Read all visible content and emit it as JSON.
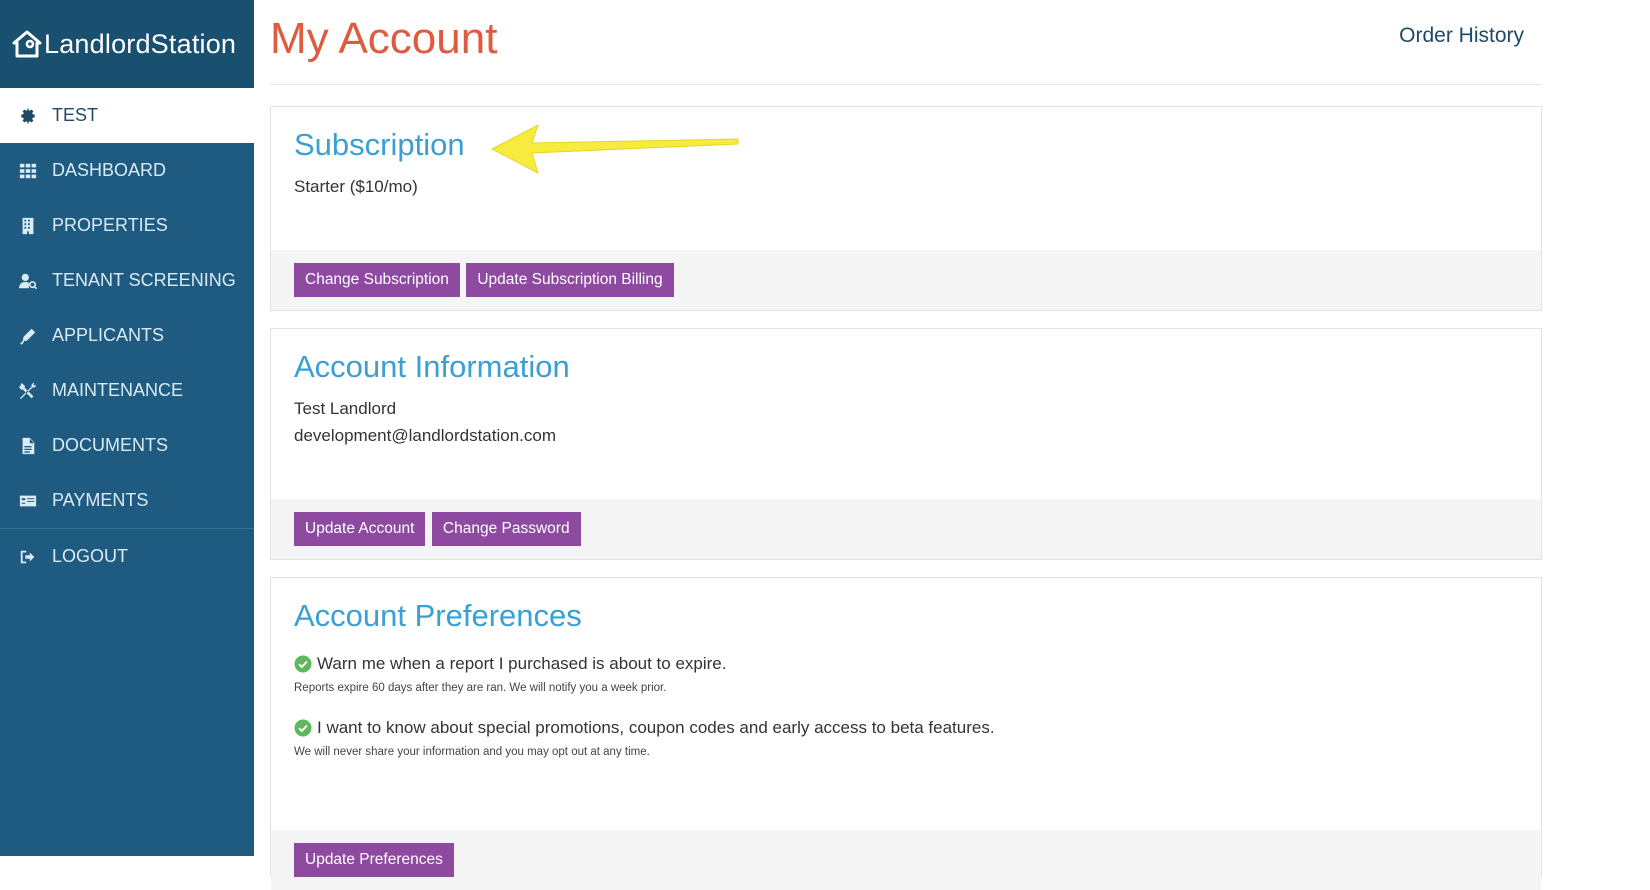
{
  "brand": {
    "name": "LandlordStation"
  },
  "sidebar": {
    "items": [
      {
        "label": "TEST",
        "icon": "gear-icon"
      },
      {
        "label": "DASHBOARD",
        "icon": "grid-icon"
      },
      {
        "label": "PROPERTIES",
        "icon": "building-icon"
      },
      {
        "label": "TENANT SCREENING",
        "icon": "user-search-icon"
      },
      {
        "label": "APPLICANTS",
        "icon": "pen-icon"
      },
      {
        "label": "MAINTENANCE",
        "icon": "tools-icon"
      },
      {
        "label": "DOCUMENTS",
        "icon": "document-icon"
      },
      {
        "label": "PAYMENTS",
        "icon": "payment-card-icon"
      },
      {
        "label": "LOGOUT",
        "icon": "logout-icon"
      }
    ]
  },
  "header": {
    "title": "My Account",
    "order_history": "Order History"
  },
  "subscription": {
    "title": "Subscription",
    "plan": "Starter ($10/mo)",
    "buttons": {
      "change": "Change Subscription",
      "update_billing": "Update Subscription Billing"
    }
  },
  "account_info": {
    "title": "Account Information",
    "name": "Test Landlord",
    "email": "development@landlordstation.com",
    "buttons": {
      "update": "Update Account",
      "password": "Change Password"
    }
  },
  "preferences": {
    "title": "Account Preferences",
    "items": [
      {
        "label": "Warn me when a report I purchased is about to expire.",
        "note": "Reports expire 60 days after they are ran. We will notify you a week prior."
      },
      {
        "label": "I want to know about special promotions, coupon codes and early access to beta features.",
        "note": "We will never share your information and you may opt out at any time."
      }
    ],
    "button": "Update Preferences"
  },
  "colors": {
    "sidebar": "#1f5b80",
    "title": "#df5b3f",
    "section_title": "#3aa0d3",
    "button": "#8e4aa0",
    "annotation_arrow": "#f7ec3d"
  }
}
